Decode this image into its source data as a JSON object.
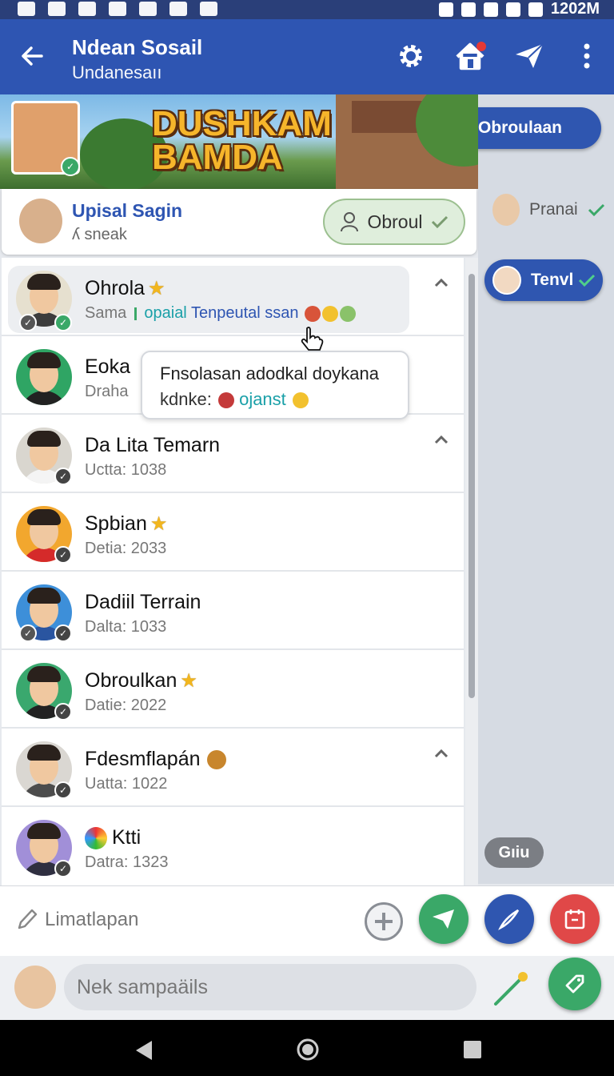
{
  "status_bar": {
    "time": "1202M"
  },
  "app_bar": {
    "title": "Ndean Sosail",
    "subtitle": "Undanesaıı"
  },
  "banner": {
    "line1": "DUSHKAM",
    "line2": "BAMDA"
  },
  "profile": {
    "name": "Upisal Sagin",
    "sub": "ʎ sneak",
    "button_label": "Obroul"
  },
  "side_panel": {
    "pill1_label": "Obroulaan",
    "contact_label": "Pranai",
    "pill2_label": "Tenvl",
    "bubble_label": "Gıiu"
  },
  "contacts": [
    {
      "name": "Ohrola",
      "sub_a": "Sama",
      "sub_b": "opaial",
      "sub_c": "Tenpeutal ssan"
    },
    {
      "name": "Eoka",
      "sub": "Draha"
    },
    {
      "name": "Da Lita Temarn",
      "sub": "Uctta: 1038"
    },
    {
      "name": "Spbian",
      "sub": "Detia: 2033"
    },
    {
      "name": "Dadiil Terrain",
      "sub": "Dalta: 1033"
    },
    {
      "name": "Obroulkan",
      "sub": "Datie: 2022"
    },
    {
      "name": "Fdesmflapán",
      "sub": "Uatta: 1022"
    },
    {
      "name": "Ktti",
      "sub": "Datra: 1323"
    }
  ],
  "tooltip": {
    "line1": "Fnsolasan adodkal doykana",
    "line2_a": "kdnke:",
    "line2_b": "ojanst"
  },
  "composer": {
    "placeholder": "Limatlapan"
  },
  "bottom_input": {
    "placeholder": "Nek sampaäils"
  },
  "colors": {
    "primary": "#2e55b2",
    "green_fab": "#3aa868",
    "blue_fab": "#2f56b0",
    "red_fab": "#e04848"
  }
}
